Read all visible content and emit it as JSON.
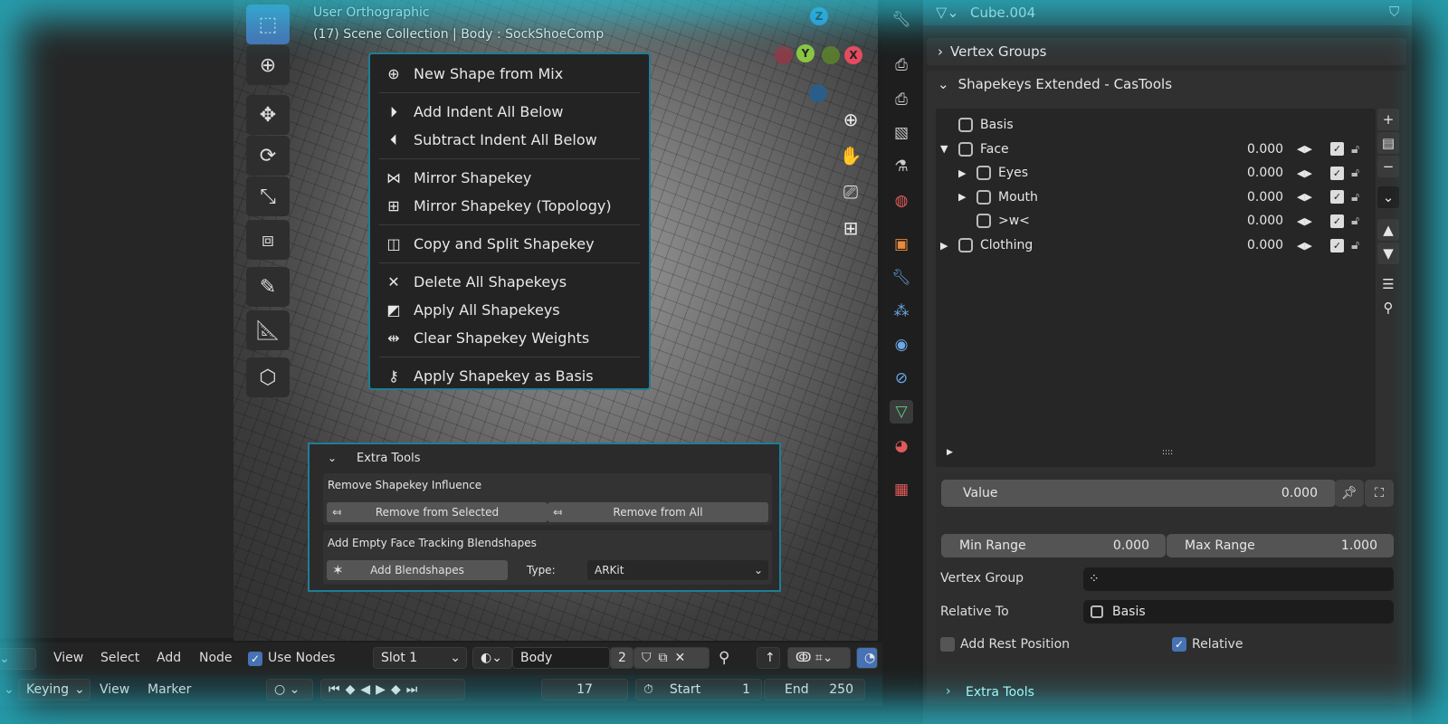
{
  "viewport": {
    "view_name": "User Orthographic",
    "context": "(17) Scene Collection | Body : SockShoeComp",
    "tools": [
      "select-box-icon",
      "cursor-icon",
      "move-icon",
      "rotate-icon",
      "scale-icon",
      "transform-icon",
      "annotate-icon",
      "measure-icon",
      "add-cube-icon"
    ],
    "gizmo": {
      "z": "Z",
      "y": "Y",
      "x": "X"
    }
  },
  "context_menu": {
    "items": [
      {
        "label": "New Shape from Mix",
        "icon": "plus-circle-icon",
        "glyph": "⊕"
      },
      {
        "sep": true
      },
      {
        "label": "Add Indent All Below",
        "icon": "indent-icon",
        "glyph": "⏵"
      },
      {
        "label": "Subtract Indent All Below",
        "icon": "outdent-icon",
        "glyph": "⏴"
      },
      {
        "sep": true
      },
      {
        "label": "Mirror Shapekey",
        "icon": "mirror-icon",
        "glyph": "⋈"
      },
      {
        "label": "Mirror Shapekey (Topology)",
        "icon": "grid-icon",
        "glyph": "⊞"
      },
      {
        "sep": true
      },
      {
        "label": "Copy and Split Shapekey",
        "icon": "split-icon",
        "glyph": "◫"
      },
      {
        "sep": true
      },
      {
        "label": "Delete All Shapekeys",
        "icon": "x-icon",
        "glyph": "✕"
      },
      {
        "label": "Apply All Shapekeys",
        "icon": "apply-icon",
        "glyph": "◩"
      },
      {
        "label": "Clear Shapekey Weights",
        "icon": "weights-icon",
        "glyph": "⇹"
      },
      {
        "sep": true
      },
      {
        "label": "Apply Shapekey as Basis",
        "icon": "key-plus-icon",
        "glyph": "⚷"
      }
    ]
  },
  "extra_tools_popup": {
    "title": "Extra Tools",
    "section1": "Remove Shapekey Influence",
    "remove_selected": "Remove from Selected",
    "remove_all": "Remove from All",
    "section2": "Add Empty Face Tracking Blendshapes",
    "add_blendshapes": "Add Blendshapes",
    "type_label": "Type:",
    "type_value": "ARKit"
  },
  "properties": {
    "object_name": "Cube.004",
    "vertex_groups": "Vertex Groups",
    "shapekeys_panel": "Shapekeys Extended - CasTools",
    "shapekeys": [
      {
        "name": "Basis",
        "indent": 0,
        "expander": "",
        "value": ""
      },
      {
        "name": "Face",
        "indent": 0,
        "expander": "▼",
        "value": "0.000",
        "enabled": true
      },
      {
        "name": "Eyes",
        "indent": 1,
        "expander": "▶",
        "value": "0.000",
        "enabled": true
      },
      {
        "name": "Mouth",
        "indent": 1,
        "expander": "▶",
        "value": "0.000",
        "enabled": true
      },
      {
        "name": ">w<",
        "indent": 1,
        "expander": "",
        "value": "0.000",
        "enabled": true
      },
      {
        "name": "Clothing",
        "indent": 0,
        "expander": "▶",
        "value": "0.000",
        "enabled": true
      }
    ],
    "value_label": "Value",
    "value": "0.000",
    "min_range_label": "Min Range",
    "min_range": "0.000",
    "max_range_label": "Max Range",
    "max_range": "1.000",
    "vertex_group_label": "Vertex Group",
    "vertex_group": "",
    "relative_to_label": "Relative To",
    "relative_to": "Basis",
    "add_rest_label": "Add Rest Position",
    "add_rest": false,
    "relative_label": "Relative",
    "relative": true,
    "extra_tools": "Extra Tools"
  },
  "node_header": {
    "view": "View",
    "select": "Select",
    "add": "Add",
    "node": "Node",
    "use_nodes": "Use Nodes",
    "slot": "Slot 1",
    "material": "Body",
    "users": "2"
  },
  "timeline": {
    "keying": "Keying",
    "view": "View",
    "marker": "Marker",
    "frame": "17",
    "start_label": "Start",
    "start": "1",
    "end_label": "End",
    "end": "250"
  },
  "colors": {
    "accent": "#4772b3",
    "highlight_border": "#1f7d95",
    "glow": "#28c8dc"
  }
}
